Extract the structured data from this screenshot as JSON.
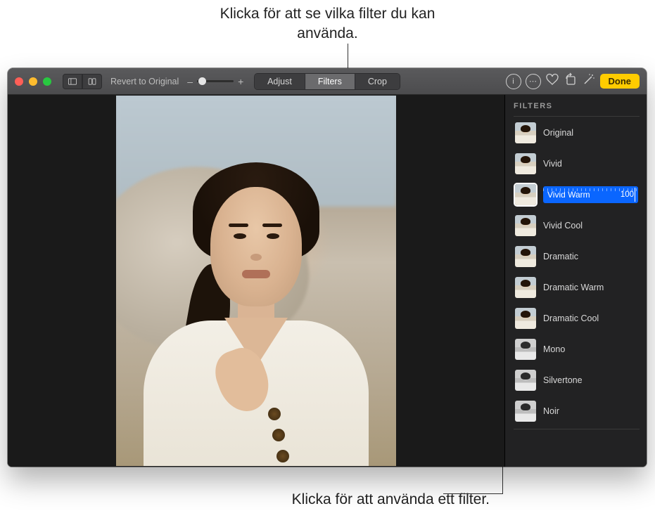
{
  "callouts": {
    "top": "Klicka för att se vilka filter du kan använda.",
    "bottom": "Klicka för att använda ett filter."
  },
  "toolbar": {
    "revert_label": "Revert to Original",
    "zoom_minus": "–",
    "zoom_plus": "+",
    "segments": {
      "adjust": "Adjust",
      "filters": "Filters",
      "crop": "Crop"
    },
    "active_segment": "filters",
    "done_label": "Done"
  },
  "sidebar": {
    "title": "FILTERS",
    "selected": "vivid_warm",
    "selected_value": "100",
    "filters": [
      {
        "key": "original",
        "label": "Original",
        "bw": false
      },
      {
        "key": "vivid",
        "label": "Vivid",
        "bw": false
      },
      {
        "key": "vivid_warm",
        "label": "Vivid Warm",
        "bw": false
      },
      {
        "key": "vivid_cool",
        "label": "Vivid Cool",
        "bw": false
      },
      {
        "key": "dramatic",
        "label": "Dramatic",
        "bw": false
      },
      {
        "key": "dramatic_warm",
        "label": "Dramatic Warm",
        "bw": false
      },
      {
        "key": "dramatic_cool",
        "label": "Dramatic Cool",
        "bw": false
      },
      {
        "key": "mono",
        "label": "Mono",
        "bw": true
      },
      {
        "key": "silvertone",
        "label": "Silvertone",
        "bw": true
      },
      {
        "key": "noir",
        "label": "Noir",
        "bw": true
      }
    ]
  }
}
